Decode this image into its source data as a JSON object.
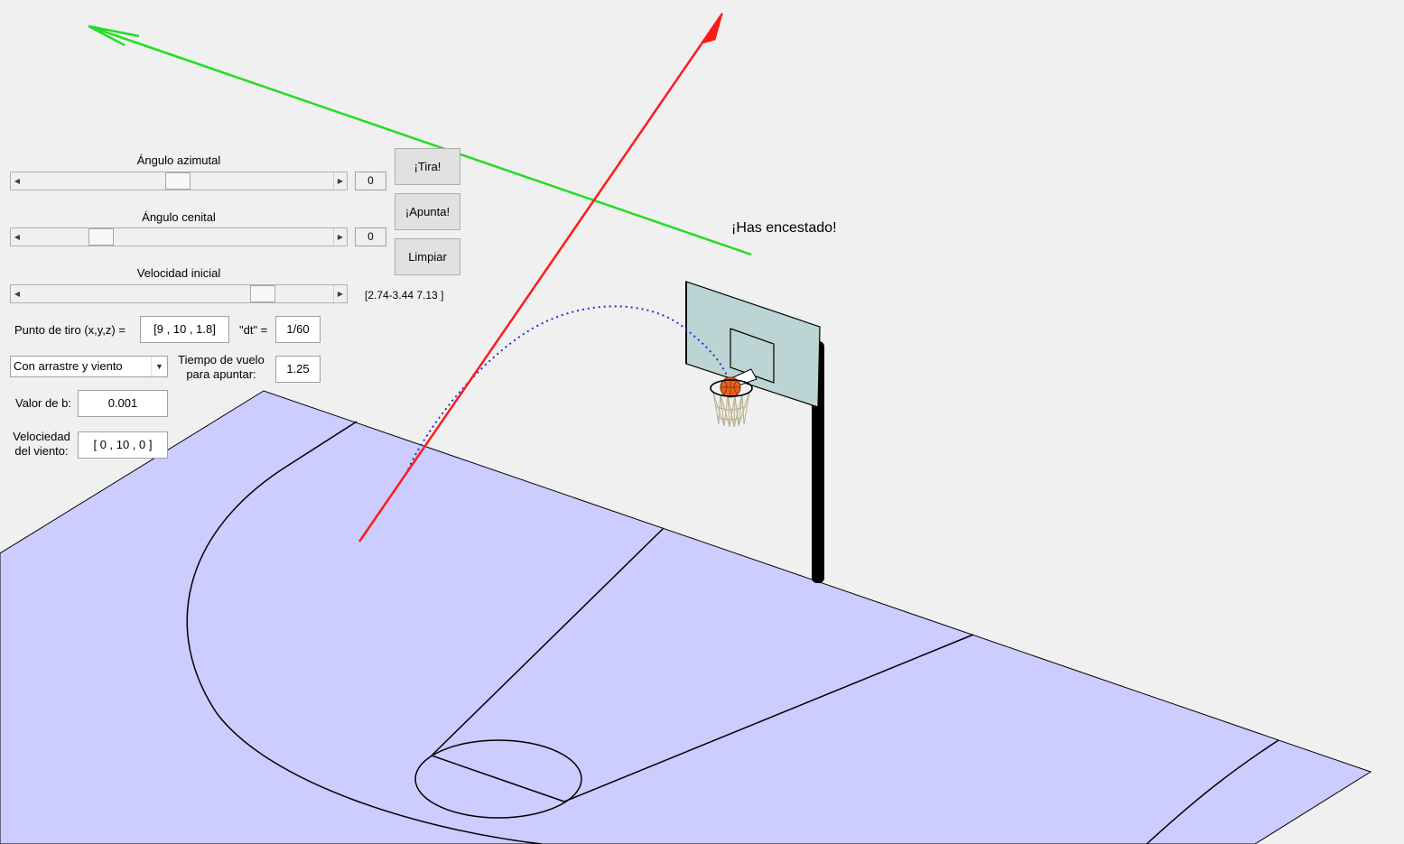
{
  "sliders": {
    "azimuth": {
      "label": "Ángulo azimutal",
      "value": "0",
      "position": 0.5
    },
    "zenith": {
      "label": "Ángulo cenital",
      "value": "0",
      "position": 0.23
    },
    "velocity": {
      "label": "Velocidad inicial",
      "range_text": "[2.74-3.44 7.13 ]",
      "position": 0.8
    }
  },
  "buttons": {
    "shoot": "¡Tira!",
    "aim": "¡Apunta!",
    "clear": "Limpiar"
  },
  "fields": {
    "shot_point_label": "Punto de tiro (x,y,z) =",
    "shot_point_value": "[9 , 10 , 1.8]",
    "dt_label": "\"dt\" =",
    "dt_value": "1/60",
    "model_select": "Con arrastre y viento",
    "flight_time_label_1": "Tiempo de vuelo",
    "flight_time_label_2": "para apuntar:",
    "flight_time_value": "1.25",
    "b_label": "Valor de b:",
    "b_value": "0.001",
    "wind_label_1": "Velociedad",
    "wind_label_2": "del viento:",
    "wind_value": "[ 0 , 10 , 0 ]"
  },
  "status": {
    "message": "¡Has encestado!"
  },
  "colors": {
    "court": "#ccccff",
    "backboard": "#bcd4d4",
    "arrow_x": "#ff1a1a",
    "arrow_y": "#22dd22",
    "trajectory": "#1f2fd6",
    "ball": "#e8601c"
  }
}
